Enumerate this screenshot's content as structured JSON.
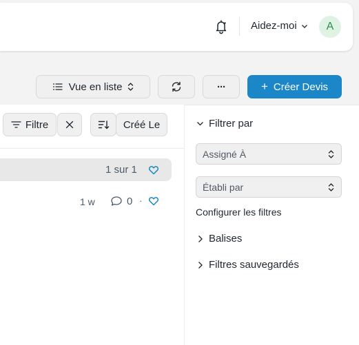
{
  "navbar": {
    "help_label": "Aidez-moi",
    "avatar_initial": "A",
    "avatar_bg": "#dff3e5",
    "avatar_fg": "#2f8a52"
  },
  "toolbar": {
    "view_label": "Vue en liste",
    "more_label": "···",
    "create_label": "Créer Devis",
    "create_prefix": "+",
    "accent": "#1b87c9"
  },
  "filters": {
    "filter_label": "Filtre",
    "sort_field_label": "Créé Le"
  },
  "list": {
    "count_text": "1 sur 1",
    "row": {
      "time": "1 w",
      "comments": "0",
      "separator": "·"
    }
  },
  "sidebar": {
    "filter_by_label": "Filtrer par",
    "assigned_label": "Assigné À",
    "established_label": "Établi par",
    "configure_label": "Configurer les filtres",
    "tags_label": "Balises",
    "saved_filters_label": "Filtres sauvegardés"
  }
}
